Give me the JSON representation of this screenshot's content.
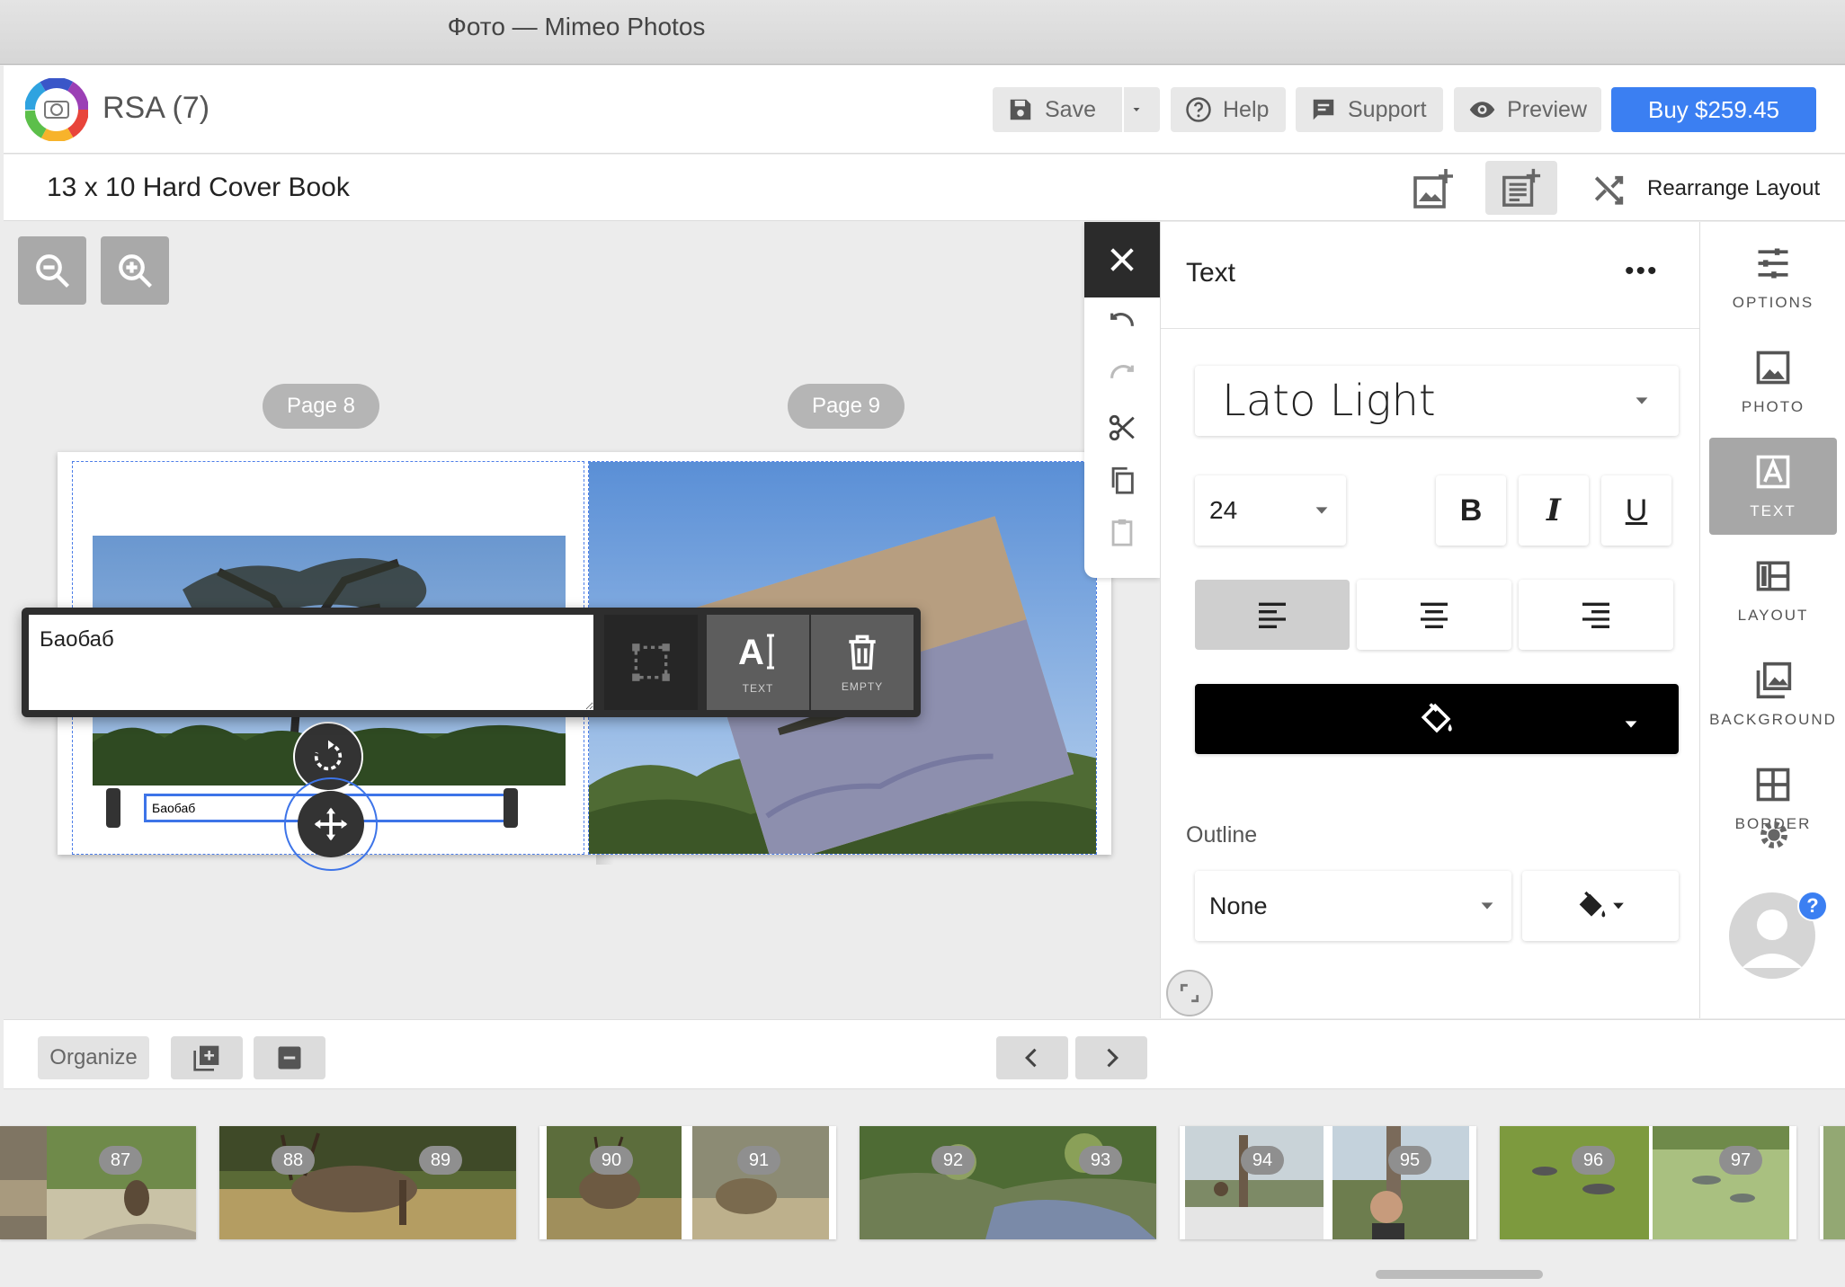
{
  "window": {
    "title": "Фото — Mimeo Photos"
  },
  "header": {
    "project_name": "RSA (7)",
    "save_label": "Save",
    "help_label": "Help",
    "support_label": "Support",
    "preview_label": "Preview",
    "buy_label": "Buy $259.45"
  },
  "subbar": {
    "book_title": "13 x 10 Hard Cover Book",
    "rearrange_label": "Rearrange Layout"
  },
  "canvas": {
    "page_left_label": "Page 8",
    "page_right_label": "Page 9",
    "text_box_content": "Баобаб"
  },
  "text_popover": {
    "text_value": "Баобаб",
    "text_mode_label": "TEXT",
    "empty_label": "EMPTY"
  },
  "text_panel": {
    "title": "Text",
    "more_label": "•••",
    "font": "Lato Light",
    "size": "24",
    "bold_label": "B",
    "italic_label": "I",
    "underline_label": "U",
    "color": "#000000",
    "outline_label": "Outline",
    "outline_value": "None"
  },
  "sidebar": {
    "items": [
      {
        "label": "OPTIONS",
        "icon": "sliders-icon"
      },
      {
        "label": "PHOTO",
        "icon": "photo-icon"
      },
      {
        "label": "TEXT",
        "icon": "text-icon",
        "active": true
      },
      {
        "label": "LAYOUT",
        "icon": "layout-icon"
      },
      {
        "label": "BACKGROUND",
        "icon": "background-icon"
      },
      {
        "label": "BORDER",
        "icon": "border-icon"
      }
    ],
    "help_badge": "?"
  },
  "pager": {
    "organize_label": "Organize"
  },
  "filmstrip": {
    "pages": [
      "87",
      "88",
      "89",
      "90",
      "91",
      "92",
      "93",
      "94",
      "95",
      "96",
      "97"
    ]
  },
  "colors": {
    "accent": "#3b7ff2",
    "selection": "#3d74e8",
    "active_sidebar": "#a7a7a7"
  }
}
